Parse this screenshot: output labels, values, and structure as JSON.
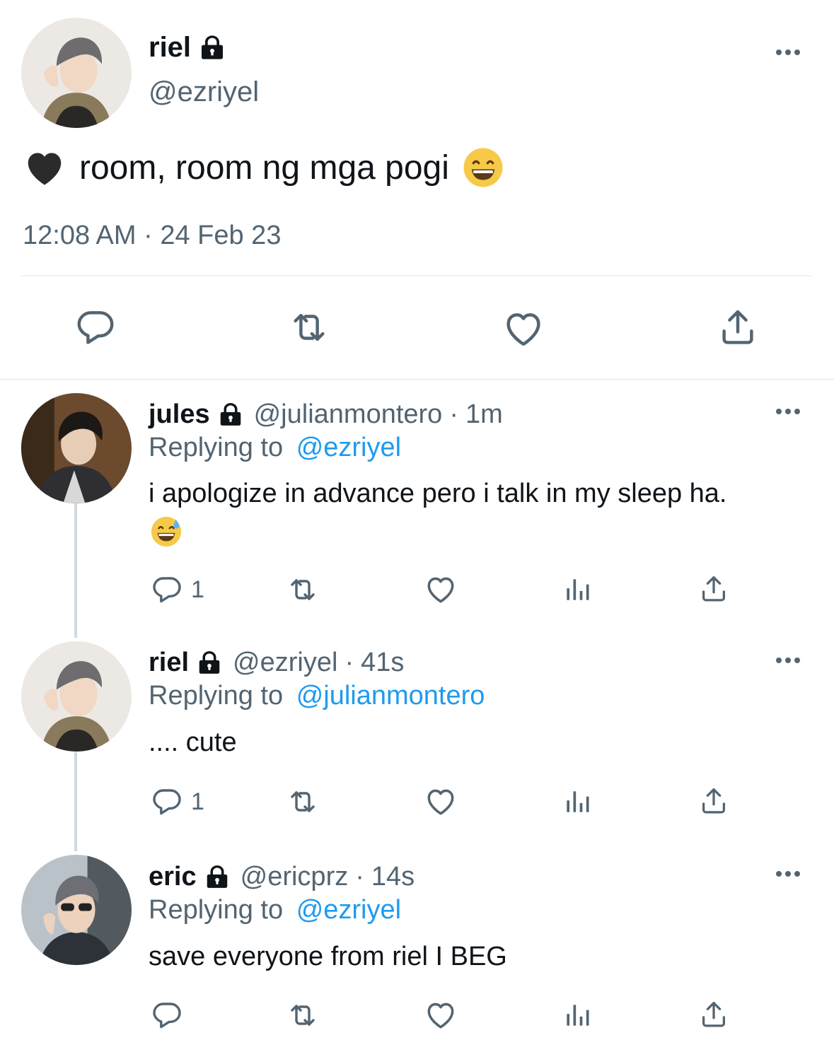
{
  "main_tweet": {
    "display_name": "riel",
    "handle": "@ezriyel",
    "text": "room, room ng mga pogi",
    "leading_emoji": "black-heart-emoji",
    "trailing_emoji": "grinning-face-emoji",
    "timestamp": "12:08 AM · 24 Feb 23",
    "actions": [
      "reply-icon",
      "retweet-icon",
      "like-icon",
      "share-icon"
    ]
  },
  "replies": [
    {
      "display_name": "jules",
      "handle": "@julianmontero",
      "time": "1m",
      "replying_prefix": "Replying to",
      "replying_to": "@ezriyel",
      "text": "i apologize in advance pero i talk in my sleep ha.",
      "emoji": "grinning-sweat-emoji",
      "reply_count": "1"
    },
    {
      "display_name": "riel",
      "handle": "@ezriyel",
      "time": "41s",
      "replying_prefix": "Replying to",
      "replying_to": "@julianmontero",
      "text": ".... cute",
      "reply_count": "1"
    },
    {
      "display_name": "eric",
      "handle": "@ericprz",
      "time": "14s",
      "replying_prefix": "Replying to",
      "replying_to": "@ezriyel",
      "text": "save everyone from riel I BEG",
      "reply_count": ""
    }
  ],
  "colors": {
    "text": "#0f1419",
    "muted": "#536471",
    "link": "#1d9bf0",
    "divider": "#eff3f4"
  }
}
